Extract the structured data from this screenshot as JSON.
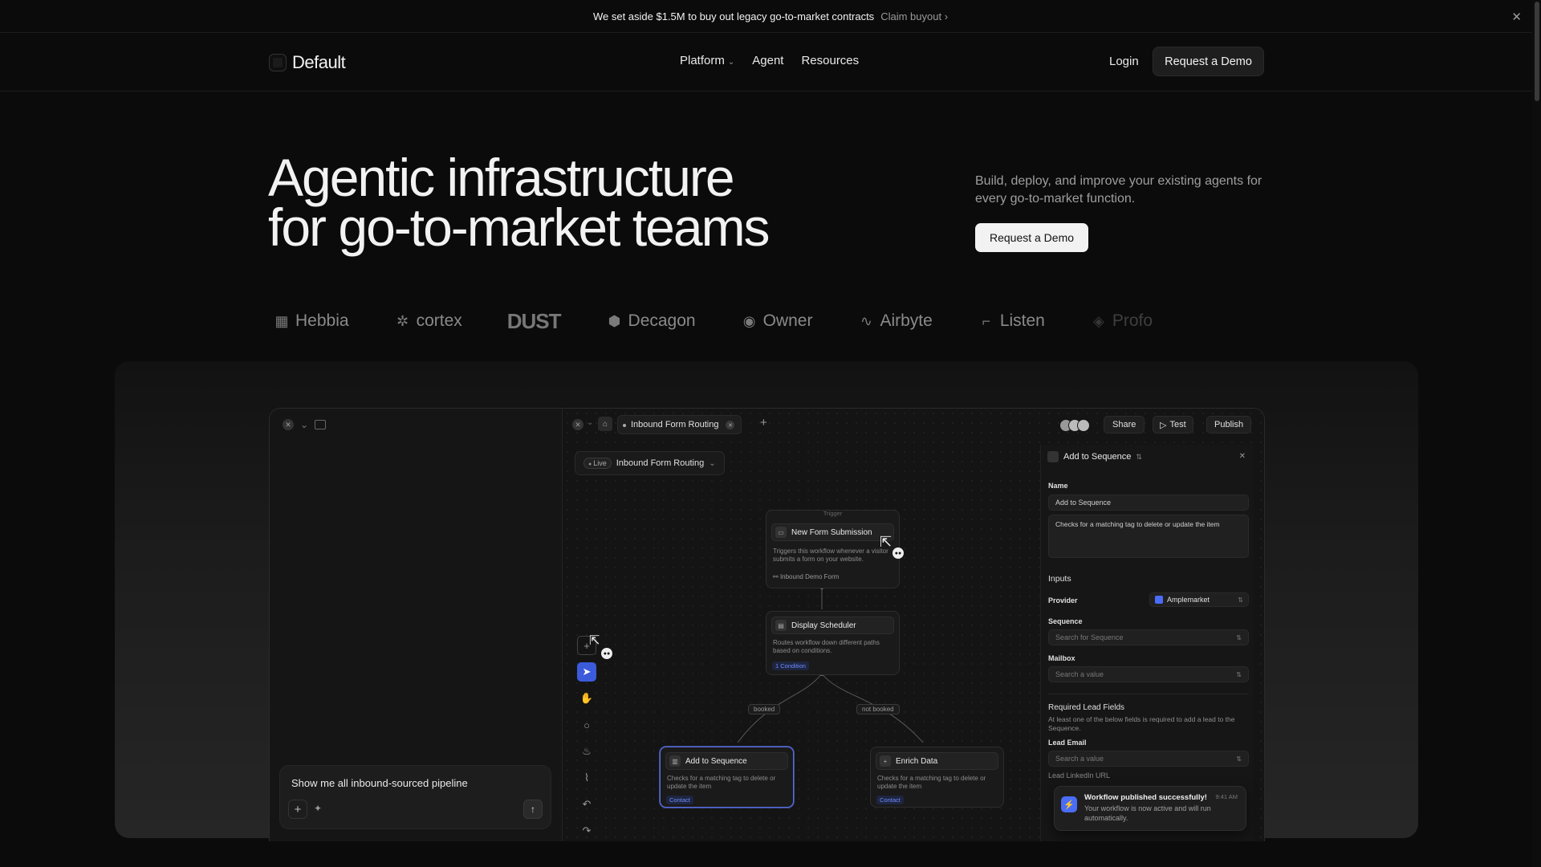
{
  "banner": {
    "message": "We set aside $1.5M to buy out legacy go-to-market contracts",
    "cta": "Claim buyout",
    "cta_icon": "chevron-right-icon",
    "close_icon": "close-icon"
  },
  "nav": {
    "brand": "Default",
    "menu": [
      {
        "label": "Platform",
        "has_dropdown": true
      },
      {
        "label": "Agent"
      },
      {
        "label": "Resources"
      }
    ],
    "login": "Login",
    "demo": "Request a Demo"
  },
  "hero": {
    "title_line1": "Agentic infrastructure",
    "title_line2": "for go-to-market teams",
    "subtitle": "Build, deploy, and improve your existing agents for every go-to-market function.",
    "cta": "Request a Demo"
  },
  "logos": [
    "Hebbia",
    "cortex",
    "DUST",
    "Decagon",
    "Owner",
    "Airbyte",
    "Listen",
    "Profo"
  ],
  "app": {
    "chat": {
      "prompt": "Show me all inbound-sourced pipeline",
      "add_label": "+",
      "send_icon": "arrow-up-icon"
    },
    "tab": {
      "label": "Inbound Form Routing"
    },
    "actions": {
      "share": "Share",
      "test": "Test",
      "publish": "Publish"
    },
    "workflow": {
      "status": "Live",
      "name": "Inbound Form Routing"
    },
    "nodes": {
      "trigger": {
        "kind": "Trigger",
        "title": "New Form Submission",
        "desc": "Triggers this workflow whenever a visitor submits a form on your website.",
        "source": "Inbound Demo Form"
      },
      "scheduler": {
        "title": "Display Scheduler",
        "desc": "Routes workflow down different paths based on conditions.",
        "tag": "1 Condition"
      },
      "branch_left": "booked",
      "branch_right": "not booked",
      "sequence": {
        "title": "Add to Sequence",
        "desc": "Checks for a matching tag to delete or update the item",
        "tag": "Contact"
      },
      "enrich": {
        "title": "Enrich Data",
        "desc": "Checks for a matching tag to delete or update the item",
        "tag": "Contact"
      }
    },
    "panel": {
      "title": "Add to Sequence",
      "name_label": "Name",
      "name_value": "Add to Sequence",
      "description": "Checks for a matching tag to delete or update the item",
      "inputs_heading": "Inputs",
      "provider_label": "Provider",
      "provider_value": "Amplemarket",
      "sequence_label": "Sequence",
      "sequence_placeholder": "Search for Sequence",
      "mailbox_label": "Mailbox",
      "mailbox_placeholder": "Search a value",
      "required_heading": "Required Lead Fields",
      "required_note": "At least one of the below fields is required to add a lead to the Sequence.",
      "lead_email_label": "Lead Email",
      "lead_email_placeholder": "Search a value",
      "lead_linkedin_label": "Lead LinkedIn URL"
    },
    "toast": {
      "title": "Workflow published successfully!",
      "body": "Your workflow is now active and will run automatically.",
      "time": "9:41 AM"
    }
  },
  "colors": {
    "background": "#0b0b0b",
    "accent": "#4a6cf7",
    "text": "#f2f2f2",
    "muted": "#9e9e9e"
  }
}
